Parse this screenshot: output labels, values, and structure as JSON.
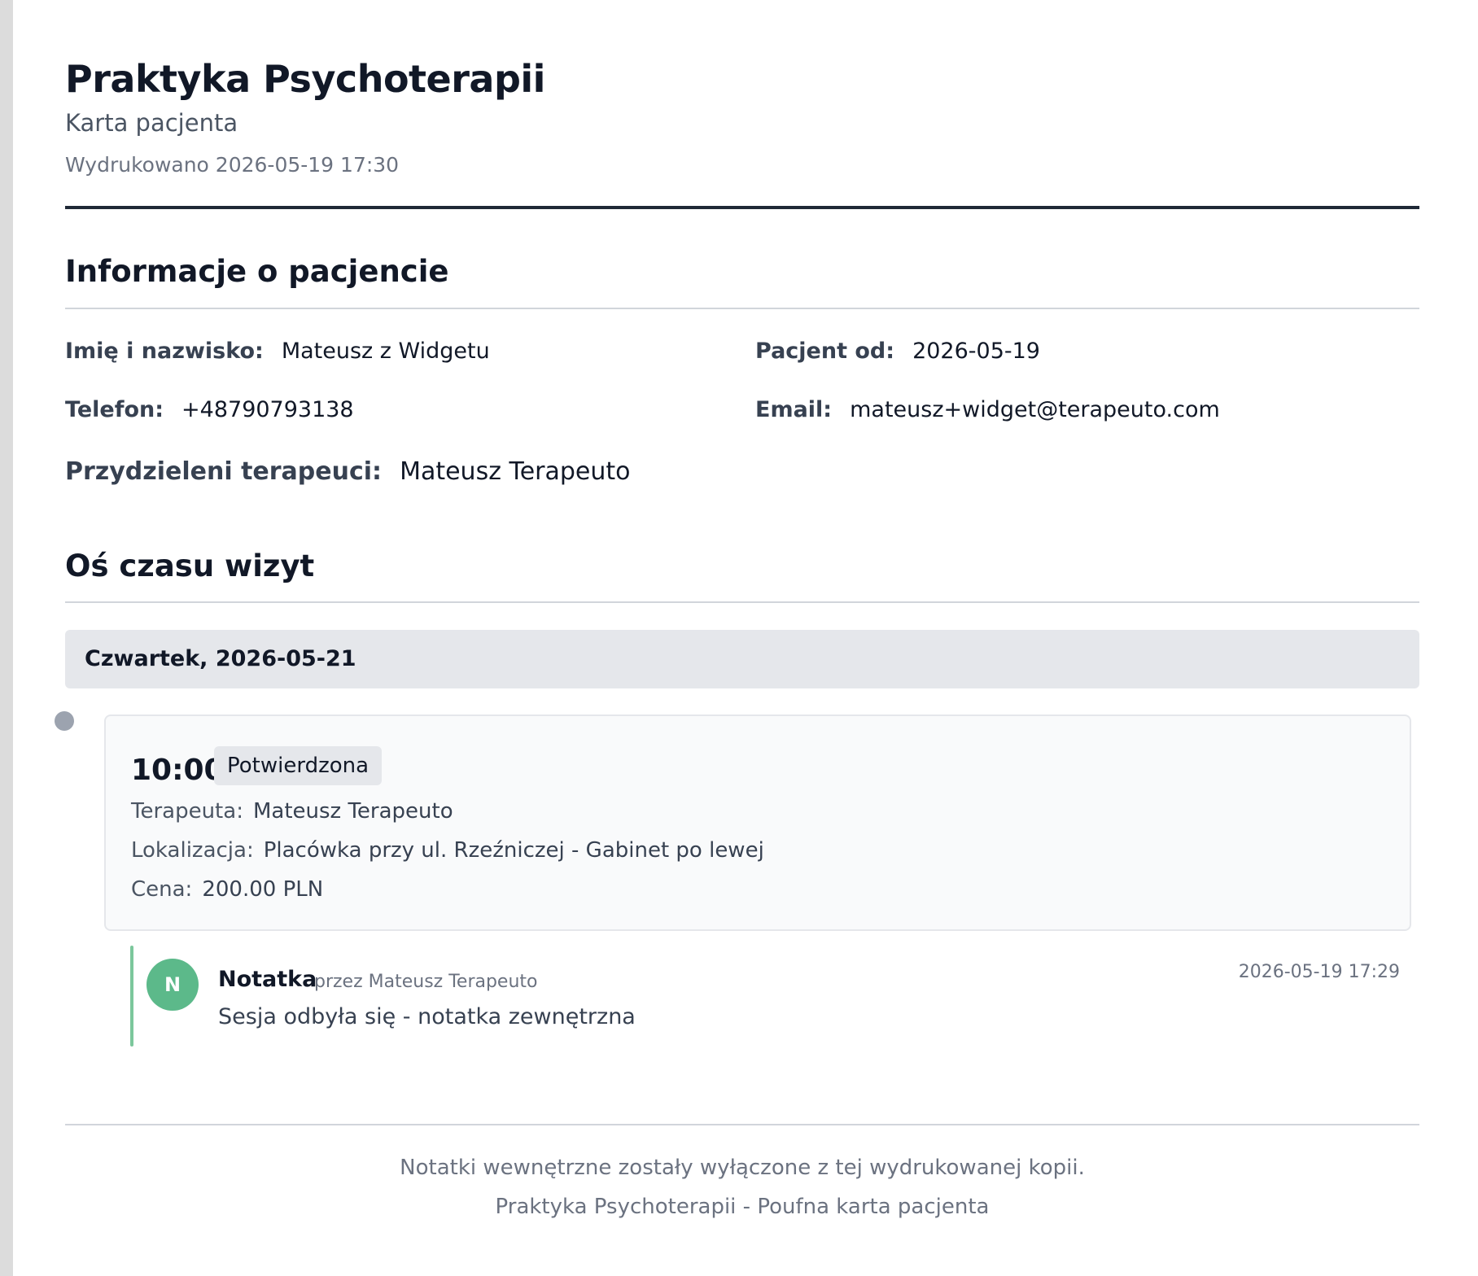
{
  "header": {
    "title": "Praktyka Psychoterapii",
    "subtitle": "Karta pacjenta",
    "printed": "Wydrukowano 2026-05-19 17:30"
  },
  "patient": {
    "section_title": "Informacje o pacjencie",
    "name_label": "Imię i nazwisko:",
    "name": "Mateusz z Widgetu",
    "since_label": "Pacjent od:",
    "since": "2026-05-19",
    "phone_label": "Telefon:",
    "phone": "+48790793138",
    "email_label": "Email:",
    "email": "mateusz+widget@terapeuto.com",
    "therapists_label": "Przydzieleni terapeuci:",
    "therapists": "Mateusz Terapeuto"
  },
  "timeline": {
    "section_title": "Oś czasu wizyt",
    "day": "Czwartek, 2026-05-21",
    "visit": {
      "time": "10:00",
      "status": "Potwierdzona",
      "therapist_label": "Terapeuta:",
      "therapist": "Mateusz Terapeuto",
      "location_label": "Lokalizacja:",
      "location": "Placówka przy ul. Rzeźniczej - Gabinet po lewej",
      "price_label": "Cena:",
      "price": "200.00 PLN"
    },
    "note": {
      "avatar": "N",
      "title": "Notatka",
      "author": "przez Mateusz Terapeuto",
      "date": "2026-05-19 17:29",
      "text": "Sesja odbyła się - notatka zewnętrzna"
    }
  },
  "footer": {
    "line1": "Notatki wewnętrzne zostały wyłączone z tej wydrukowanej kopii.",
    "line2": "Praktyka Psychoterapii - Poufna karta pacjenta"
  },
  "colors": {
    "note_accent": "#7cc79c",
    "avatar": "#5cb98a",
    "date_bar": "#e5e7eb",
    "timeline_dot": "#9ca3af"
  }
}
